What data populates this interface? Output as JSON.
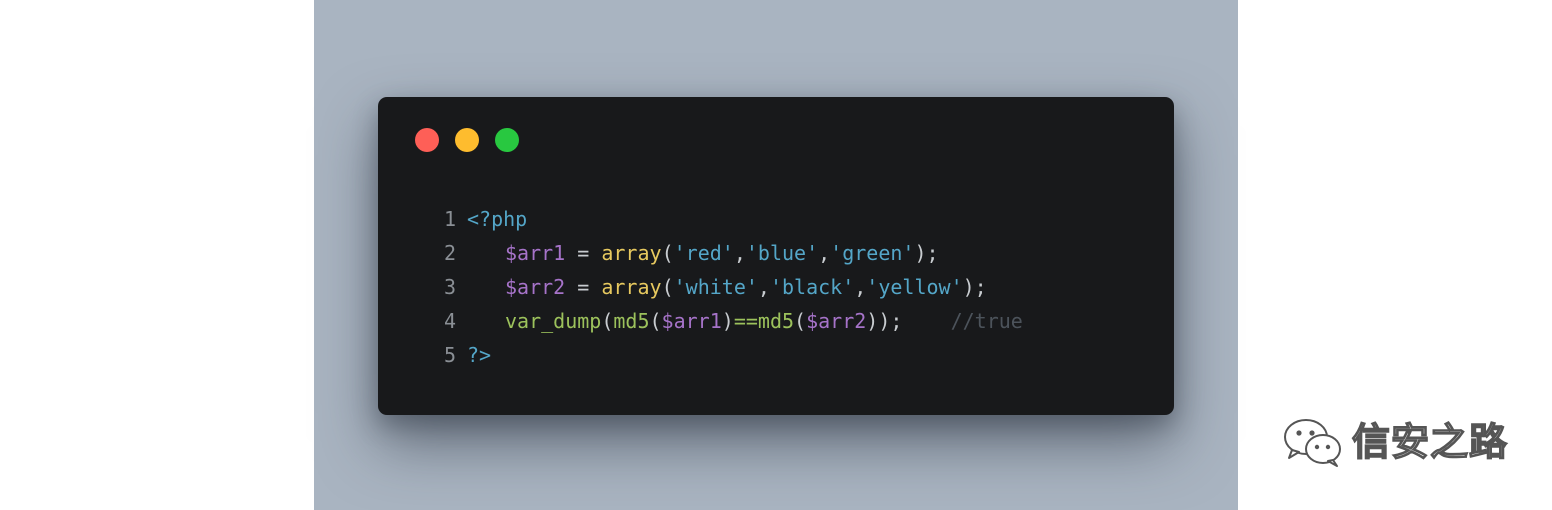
{
  "window": {
    "controls": [
      {
        "name": "close",
        "color": "#fe5f57"
      },
      {
        "name": "minimize",
        "color": "#febc2e"
      },
      {
        "name": "maximize",
        "color": "#28c840"
      }
    ]
  },
  "code": {
    "language": "php",
    "lines": [
      {
        "number": "1",
        "tokens": [
          {
            "text": "<?php",
            "kind": "tag"
          }
        ]
      },
      {
        "number": "2",
        "indent": true,
        "tokens": [
          {
            "text": "$arr1",
            "kind": "var"
          },
          {
            "text": " = ",
            "kind": "op"
          },
          {
            "text": "array",
            "kind": "fn"
          },
          {
            "text": "(",
            "kind": "punc"
          },
          {
            "text": "'red'",
            "kind": "str"
          },
          {
            "text": ",",
            "kind": "punc"
          },
          {
            "text": "'blue'",
            "kind": "str"
          },
          {
            "text": ",",
            "kind": "punc"
          },
          {
            "text": "'green'",
            "kind": "str"
          },
          {
            "text": ");",
            "kind": "punc"
          }
        ]
      },
      {
        "number": "3",
        "indent": true,
        "tokens": [
          {
            "text": "$arr2",
            "kind": "var"
          },
          {
            "text": " = ",
            "kind": "op"
          },
          {
            "text": "array",
            "kind": "fn"
          },
          {
            "text": "(",
            "kind": "punc"
          },
          {
            "text": "'white'",
            "kind": "str"
          },
          {
            "text": ",",
            "kind": "punc"
          },
          {
            "text": "'black'",
            "kind": "str"
          },
          {
            "text": ",",
            "kind": "punc"
          },
          {
            "text": "'yellow'",
            "kind": "str"
          },
          {
            "text": ");",
            "kind": "punc"
          }
        ]
      },
      {
        "number": "4",
        "indent": true,
        "tokens": [
          {
            "text": "var_dump",
            "kind": "fn2"
          },
          {
            "text": "(",
            "kind": "punc"
          },
          {
            "text": "md5",
            "kind": "fn2"
          },
          {
            "text": "(",
            "kind": "punc"
          },
          {
            "text": "$arr1",
            "kind": "var"
          },
          {
            "text": ")",
            "kind": "punc"
          },
          {
            "text": "==",
            "kind": "fn2"
          },
          {
            "text": "md5",
            "kind": "fn2"
          },
          {
            "text": "(",
            "kind": "punc"
          },
          {
            "text": "$arr2",
            "kind": "var"
          },
          {
            "text": "));",
            "kind": "punc"
          },
          {
            "text": "    ",
            "kind": "op"
          },
          {
            "text": "//true",
            "kind": "comment"
          }
        ]
      },
      {
        "number": "5",
        "tokens": [
          {
            "text": "?>",
            "kind": "tag"
          }
        ]
      }
    ]
  },
  "watermark": {
    "icon": "wechat-icon",
    "text": "信安之路"
  },
  "colors": {
    "backdrop": "#a9b4c1",
    "window_bg": "#18191b"
  }
}
